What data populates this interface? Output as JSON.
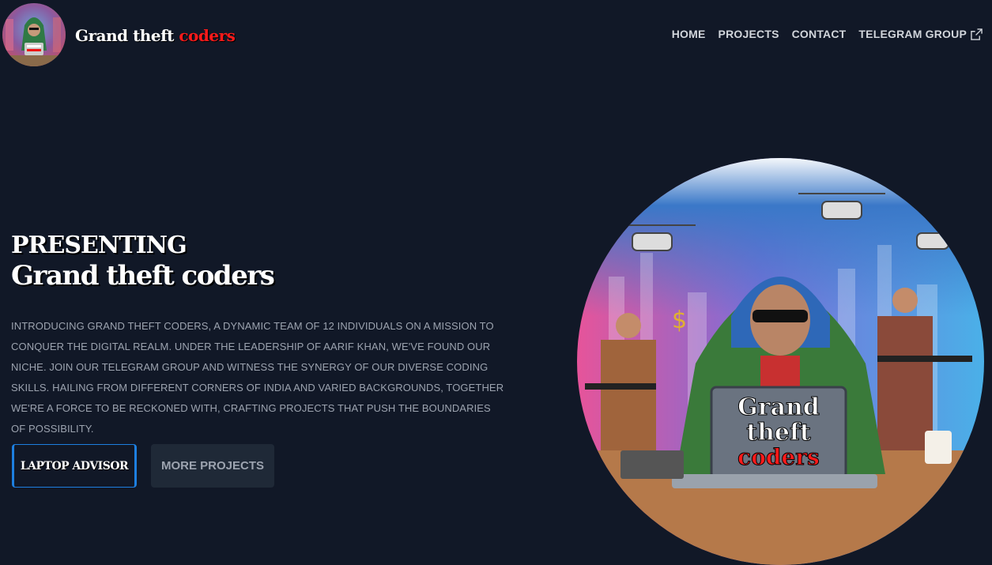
{
  "header": {
    "brand_part1": "Grand theft ",
    "brand_part2": "coders",
    "logo_icon": "gta-character-avatar"
  },
  "nav": {
    "items": [
      {
        "label": "HOME"
      },
      {
        "label": "PROJECTS"
      },
      {
        "label": "CONTACT"
      },
      {
        "label": "TELEGRAM GROUP",
        "icon": "external-link-icon"
      }
    ]
  },
  "hero": {
    "title_line1": "PRESENTING",
    "title_line2": "Grand theft coders",
    "description": "Introducing Grand Theft Coders, a dynamic team of 12 individuals on a mission to conquer the digital realm. Under the leadership of Aarif Khan, we've found our niche. Join our Telegram group and witness the synergy of our diverse coding skills. Hailing from different corners of India and varied backgrounds, together we're a force to be reckoned with, crafting projects that push the boundaries of possibility.",
    "primary_button": "LAPTOP ADVISOR",
    "secondary_button": "MORE PROJECTS",
    "image_laptop_text": [
      "Grand",
      "theft",
      "coders"
    ]
  },
  "colors": {
    "background": "#111827",
    "accent_red": "#ff1a1a",
    "button_border": "#1d7fe0"
  }
}
